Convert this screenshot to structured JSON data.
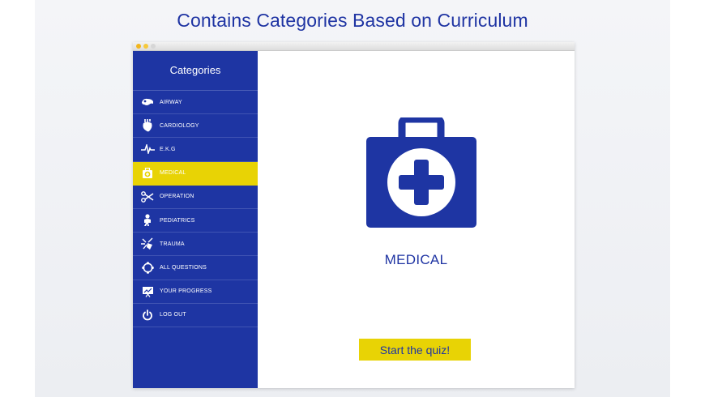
{
  "headline": "Contains Categories Based on Curriculum",
  "sidebar": {
    "title": "Categories",
    "items": [
      {
        "label": "AIRWAY",
        "icon": "airway-icon"
      },
      {
        "label": "CARDIOLOGY",
        "icon": "heart-icon"
      },
      {
        "label": "E.K.G",
        "icon": "ekg-icon"
      },
      {
        "label": "MEDICAL",
        "icon": "medical-kit-icon",
        "active": true
      },
      {
        "label": "OPERATION",
        "icon": "operation-icon"
      },
      {
        "label": "PEDIATRICS",
        "icon": "baby-icon"
      },
      {
        "label": "TRAUMA",
        "icon": "trauma-icon"
      },
      {
        "label": "ALL QUESTIONS",
        "icon": "all-questions-icon"
      },
      {
        "label": "YOUR PROGRESS",
        "icon": "progress-icon"
      },
      {
        "label": "LOG OUT",
        "icon": "power-icon"
      }
    ]
  },
  "main": {
    "icon": "medical-kit-icon",
    "title": "MEDICAL",
    "button_label": "Start the quiz!"
  },
  "colors": {
    "brand_blue": "#1e35a3",
    "accent_yellow": "#e8d305"
  }
}
